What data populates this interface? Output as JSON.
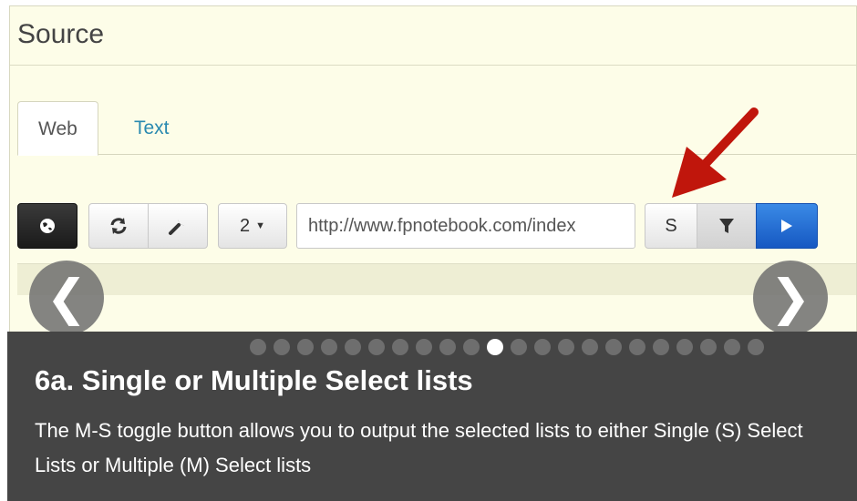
{
  "panel": {
    "title": "Source",
    "tabs": [
      {
        "label": "Web",
        "active": true
      },
      {
        "label": "Text",
        "active": false
      }
    ]
  },
  "toolbar": {
    "globe_icon": "globe-icon",
    "refresh_icon": "refresh-icon",
    "wrench_icon": "wrench-icon",
    "depth_label": "2",
    "url_value": "http://www.fpnotebook.com/index",
    "mode_label": "S",
    "filter_icon": "filter-icon",
    "play_icon": "play-icon",
    "play_color": "#1e6fd0"
  },
  "carousel": {
    "prev_glyph": "❮",
    "next_glyph": "❯",
    "total_slides": 22,
    "active_slide": 10,
    "caption_title": "6a. Single or Multiple Select lists",
    "caption_text": "The M-S toggle button allows you to output the selected lists to either Single (S) Select Lists or Multiple (M) Select lists",
    "arrow_color": "#c0160c"
  }
}
